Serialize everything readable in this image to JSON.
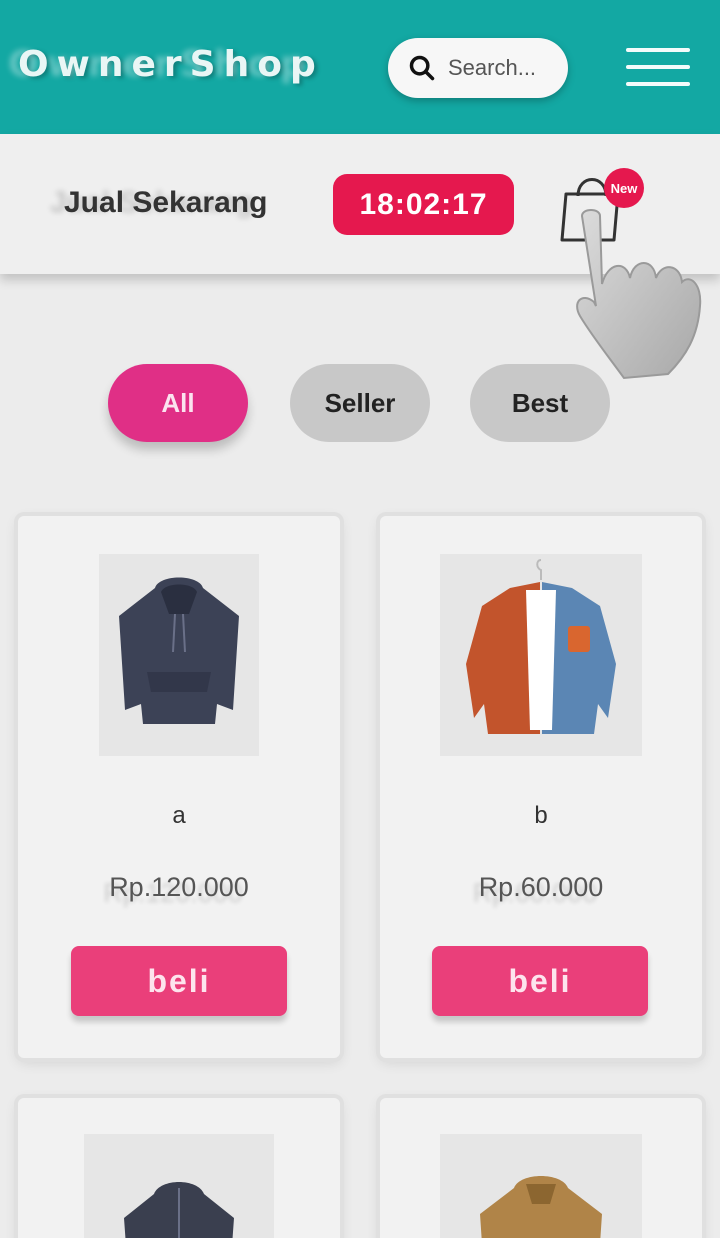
{
  "header": {
    "brand": "OwnerShop",
    "search_placeholder": "Search...",
    "search_icon": "search-icon",
    "menu_icon": "hamburger-menu-icon"
  },
  "subheader": {
    "sell_label": "Jual Sekarang",
    "timer": "18:02:17",
    "cart_icon": "shopping-bag-icon",
    "badge": "New"
  },
  "filters": [
    "All",
    "Seller",
    "Best"
  ],
  "products": [
    {
      "name": "a",
      "price": "Rp.120.000",
      "button": "beli",
      "image": "navy-hoodie"
    },
    {
      "name": "b",
      "price": "Rp.60.000",
      "button": "beli",
      "image": "orange-denim-shirt"
    },
    {
      "name": "",
      "price": "",
      "button": "",
      "image": "dark-jacket"
    },
    {
      "name": "",
      "price": "",
      "button": "",
      "image": "tan-jacket"
    }
  ],
  "colors": {
    "header_bg": "#13a8a3",
    "accent_red": "#e5184e",
    "pill_active": "#e02f86",
    "pill_inactive": "#c8c8c8",
    "buy_button": "#ea3f7a"
  }
}
